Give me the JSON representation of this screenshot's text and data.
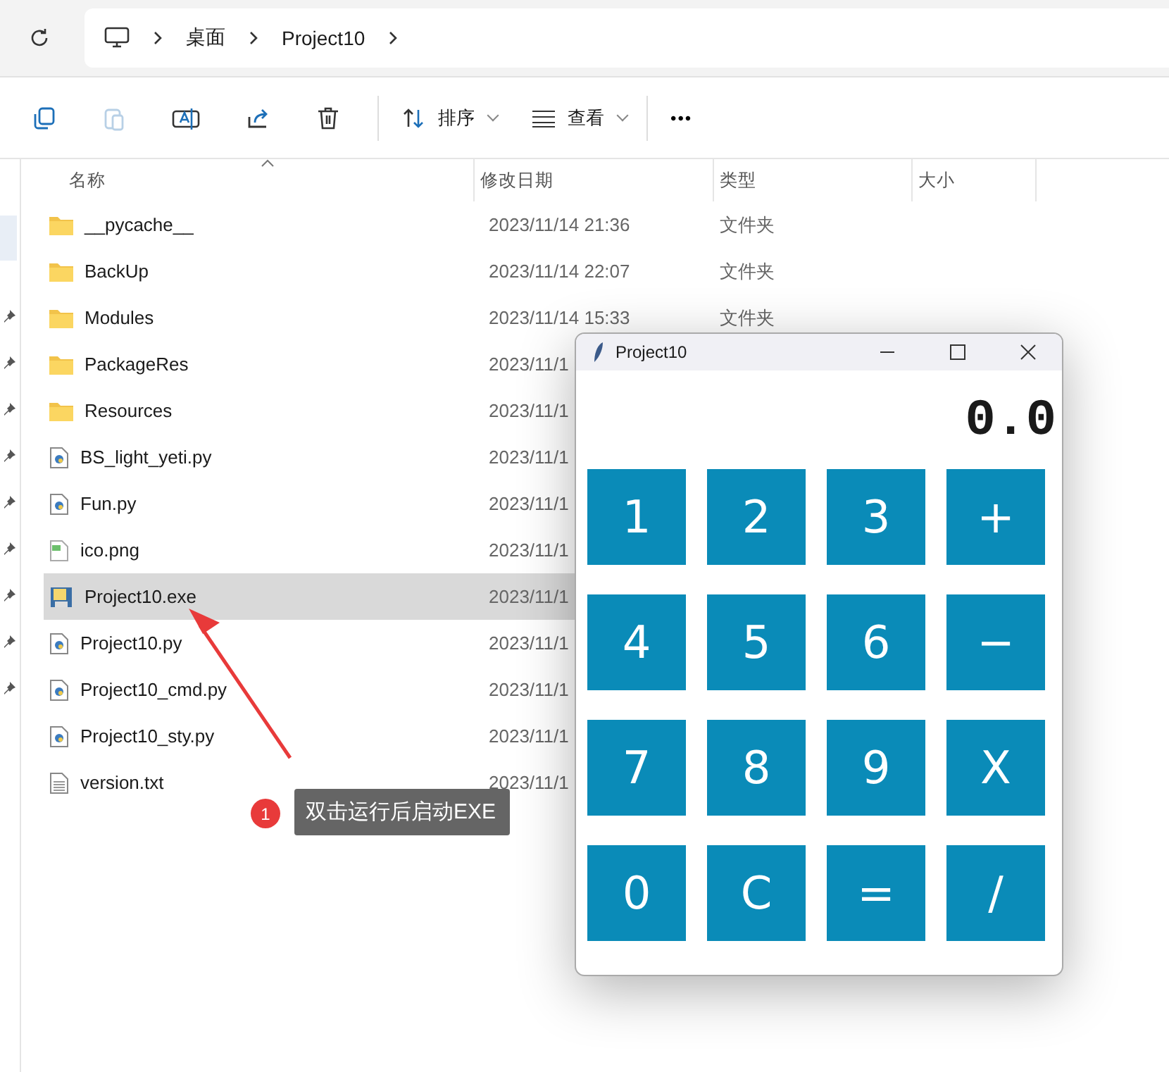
{
  "breadcrumb": [
    "桌面",
    "Project10"
  ],
  "toolbar": {
    "sort": "排序",
    "view": "查看",
    "more": "•••"
  },
  "columns": [
    "名称",
    "修改日期",
    "类型",
    "大小"
  ],
  "files": [
    {
      "name": "__pycache__",
      "kind": "folder",
      "date": "2023/11/14 21:36",
      "type": "文件夹",
      "selected": false
    },
    {
      "name": "BackUp",
      "kind": "folder",
      "date": "2023/11/14 22:07",
      "type": "文件夹",
      "selected": false
    },
    {
      "name": "Modules",
      "kind": "folder",
      "date": "2023/11/14 15:33",
      "type": "文件夹",
      "selected": false
    },
    {
      "name": "PackageRes",
      "kind": "folder",
      "date": "2023/11/1",
      "selected": false
    },
    {
      "name": "Resources",
      "kind": "folder",
      "date": "2023/11/1",
      "selected": false
    },
    {
      "name": "BS_light_yeti.py",
      "kind": "python",
      "date": "2023/11/1",
      "selected": false
    },
    {
      "name": "Fun.py",
      "kind": "python",
      "date": "2023/11/1",
      "selected": false
    },
    {
      "name": "ico.png",
      "kind": "image",
      "date": "2023/11/1",
      "selected": false
    },
    {
      "name": "Project10.exe",
      "kind": "exe",
      "date": "2023/11/1",
      "selected": true
    },
    {
      "name": "Project10.py",
      "kind": "python",
      "date": "2023/11/1",
      "selected": false
    },
    {
      "name": "Project10_cmd.py",
      "kind": "python",
      "date": "2023/11/1",
      "selected": false
    },
    {
      "name": "Project10_sty.py",
      "kind": "python",
      "date": "2023/11/1",
      "selected": false
    },
    {
      "name": "version.txt",
      "kind": "text",
      "date": "2023/11/1",
      "selected": false
    }
  ],
  "annotation": {
    "number": "1",
    "text": "双击运行后启动EXE"
  },
  "calculator": {
    "title": "Project10",
    "display": "0.0",
    "keys": [
      "1",
      "2",
      "3",
      "+",
      "4",
      "5",
      "6",
      "−",
      "7",
      "8",
      "9",
      "X",
      "0",
      "C",
      "=",
      "/"
    ]
  }
}
